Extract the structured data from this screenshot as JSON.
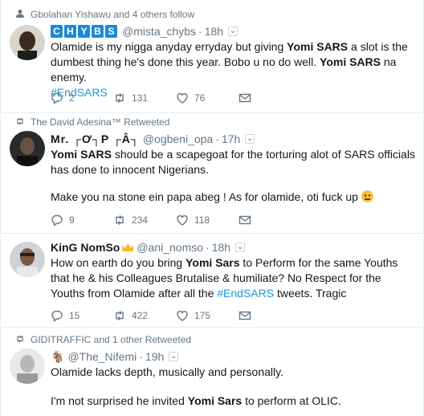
{
  "tweets": [
    {
      "context": "Gbolahan Yishawu and 4 others follow",
      "context_icon": "person-icon",
      "display_name_letters": [
        "C",
        "H",
        "Y",
        "B",
        "S"
      ],
      "handle": "@mista_chybs",
      "time": "18h",
      "text_parts": [
        "Olamide is my nigga anyday erryday but giving ",
        "Yomi SARS",
        " a slot is the dumbest thing he's done this year. Bobo u no do well. ",
        "Yomi SARS",
        " na enemy."
      ],
      "hashtag": "#EndSARS",
      "replies": "2",
      "retweets": "131",
      "likes": "76"
    },
    {
      "context": "The David Adesina™ Retweeted",
      "context_icon": "retweet-icon",
      "display_name": "Mr. ┌Ơ┐P ┌Â┐",
      "handle": "@ogbeni_opa",
      "time": "17h",
      "text_parts": [
        "Yomi SARS",
        " should be a scapegoat for the torturing  alot of SARS officials has done to innocent Nigerians."
      ],
      "text_2": "Make you na stone ein papa abeg ! As for olamide, oti fuck up",
      "replies": "9",
      "retweets": "234",
      "likes": "118"
    },
    {
      "display_name": "KinG NomSo",
      "handle": "@ani_nomso",
      "time": "18h",
      "text_parts": [
        "How on earth do you bring ",
        "Yomi Sars",
        " to Perform for the same Youths that he & his Colleagues Brutalise & humiliate? No Respect for the Youths from Olamide after all the ",
        "#EndSARS",
        " tweets. Tragic"
      ],
      "replies": "15",
      "retweets": "422",
      "likes": "175"
    },
    {
      "context": "GIDITRAFFIC and 1 other Retweeted",
      "context_icon": "retweet-icon",
      "display_name": "@The_Nifemi",
      "time": "19h",
      "text": "Olamide lacks depth, musically and personally.",
      "text_2_parts": [
        "I'm not surprised he invited ",
        "Yomi Sars",
        " to perform at OLIC."
      ]
    }
  ],
  "colors": {
    "text": "#14171a",
    "secondary": "#657786",
    "link": "#1b95e0",
    "divider": "#e6ecf0"
  }
}
